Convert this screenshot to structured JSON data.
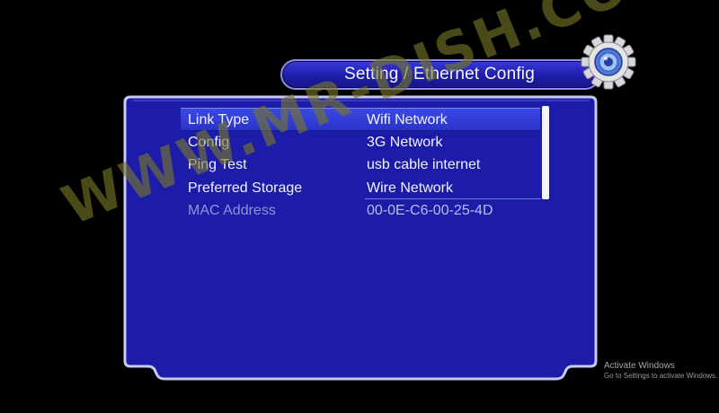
{
  "header": {
    "title": "Setting / Ethernet Config"
  },
  "menu": {
    "items": [
      {
        "label": "Link Type",
        "value": "Wifi Network",
        "selected": true,
        "enabled": true
      },
      {
        "label": "Config",
        "value": "3G Network",
        "selected": false,
        "enabled": true
      },
      {
        "label": "Ping Test",
        "value": "usb cable internet",
        "selected": false,
        "enabled": true
      },
      {
        "label": "Preferred Storage",
        "value": "Wire Network",
        "selected": false,
        "enabled": true
      },
      {
        "label": "MAC Address",
        "value": "00-0E-C6-00-25-4D",
        "selected": false,
        "enabled": false
      }
    ]
  },
  "watermark": {
    "text": "WWW.MR-DISH.COM"
  },
  "system_notice": {
    "line1": "Activate Windows",
    "line2": "Go to Settings to activate Windows."
  },
  "colors": {
    "panel": "#1c1ca8",
    "panel_border": "#c9c9f4",
    "selection": "#3440d4",
    "background": "#000000"
  },
  "icons": {
    "settings": "gear-icon"
  }
}
